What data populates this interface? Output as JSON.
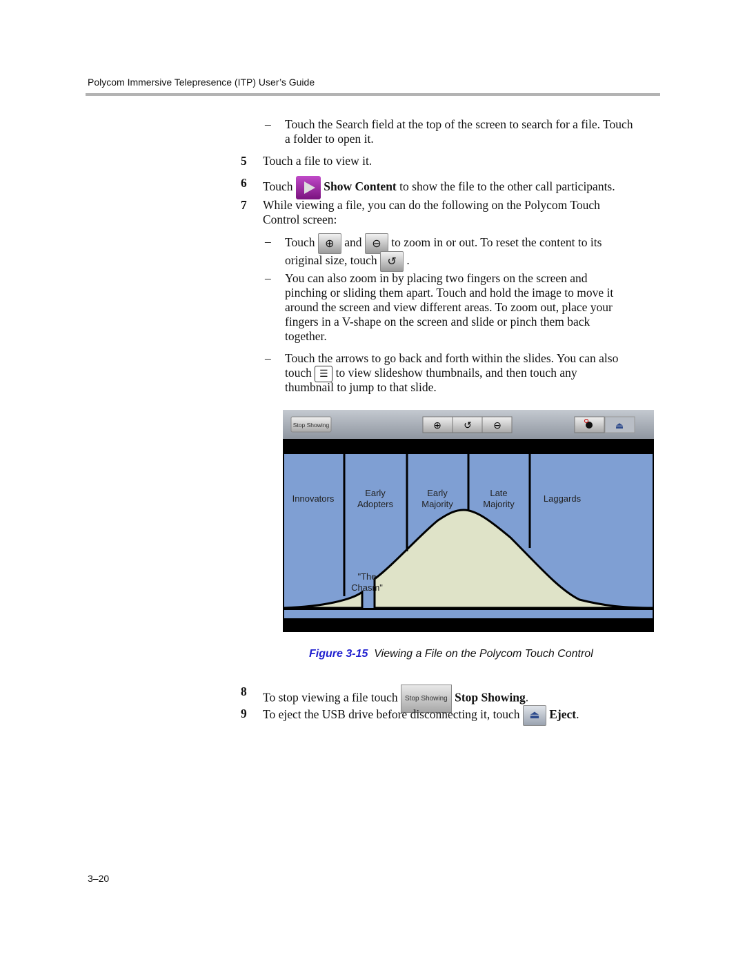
{
  "header": {
    "title": "Polycom Immersive Telepresence (ITP) User’s Guide"
  },
  "body": {
    "search_line1": "Touch the Search field at the top of the screen to search for a file. Touch",
    "search_line2": "a folder to open it.",
    "step5": {
      "num": "5",
      "text": "Touch a file to view it."
    },
    "step6": {
      "num": "6",
      "pre": "Touch",
      "bold": "Show Content",
      "post": "to show the file to the other call participants."
    },
    "step7": {
      "num": "7",
      "line1": "While viewing a file, you can do the following on the Polycom Touch",
      "line2": "Control screen:"
    },
    "zoom": {
      "touch": "Touch",
      "and": "and",
      "post": "to zoom in or out. To reset the content to its",
      "line2": "original size, touch",
      "end": "."
    },
    "pinch": [
      "You can also zoom in by placing two fingers on the screen and",
      "pinching or sliding them apart. Touch and hold the image to move it",
      "around the screen and view different areas. To zoom out, place your",
      "fingers in a V-shape on the screen and slide or pinch them back",
      "together."
    ],
    "arrows": {
      "line1": "Touch the arrows to go back and forth within the slides. You can also",
      "touch": "touch",
      "post": "to view slideshow thumbnails, and then touch any",
      "line3": "thumbnail to jump to that slide."
    },
    "step8": {
      "num": "8",
      "pre": "To stop viewing a file touch",
      "button": "Stop Showing",
      "bold": "Stop Showing",
      "end": "."
    },
    "step9": {
      "num": "9",
      "pre": "To eject the USB drive before disconnecting it, touch",
      "bold": "Eject",
      "end": "."
    },
    "dash": "–"
  },
  "figure": {
    "stop_button": "Stop Showing",
    "labels": {
      "innovators": "Innovators",
      "early_adopters": [
        "Early",
        "Adopters"
      ],
      "early_majority": [
        "Early",
        "Majority"
      ],
      "late_majority": [
        "Late",
        "Majority"
      ],
      "laggards": "Laggards",
      "chasm": [
        "\"The",
        "Chasm\""
      ]
    },
    "colors": {
      "panel": "#7f9fd3",
      "curve": "#dfe3c8",
      "toolbar": "#9aa1ab"
    },
    "caption_num": "Figure 3-15",
    "caption_text": "Viewing a File on the Polycom Touch Control"
  },
  "footer": {
    "page": "3–20"
  }
}
